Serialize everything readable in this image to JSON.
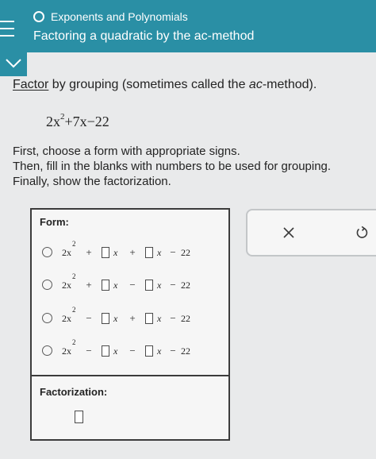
{
  "header": {
    "topic": "Exponents and Polynomials",
    "lesson": "Factoring a quadratic by the ac-method"
  },
  "icons": {
    "menu": "menu-icon",
    "topic": "circle-outline-icon",
    "collapse": "chevron-down-icon",
    "close": "close-icon",
    "undo": "undo-icon"
  },
  "problem": {
    "instruction_link": "Factor",
    "instruction_text": " by grouping (sometimes called the ",
    "instruction_ac": "ac",
    "instruction_tail": "-method).",
    "expression": {
      "coef": "2x",
      "exp": "2",
      "rest": "+7x−22"
    },
    "directions": [
      "First, choose a form with appropriate signs.",
      "Then, fill in the blanks with numbers to be used for grouping.",
      "Finally, show the factorization."
    ]
  },
  "form": {
    "label": "Form:",
    "options": [
      {
        "lead": "2x",
        "exp": "2",
        "op1": "+",
        "var1": "x",
        "op2": "+",
        "var2": "x",
        "const": "−",
        "num": "22"
      },
      {
        "lead": "2x",
        "exp": "2",
        "op1": "+",
        "var1": "x",
        "op2": "−",
        "var2": "x",
        "const": "−",
        "num": "22"
      },
      {
        "lead": "2x",
        "exp": "2",
        "op1": "−",
        "var1": "x",
        "op2": "+",
        "var2": "x",
        "const": "−",
        "num": "22"
      },
      {
        "lead": "2x",
        "exp": "2",
        "op1": "−",
        "var1": "x",
        "op2": "−",
        "var2": "x",
        "const": "−",
        "num": "22"
      }
    ]
  },
  "factorization": {
    "label": "Factorization:"
  },
  "colors": {
    "header": "#2a8fa5",
    "background": "#e9eaeb",
    "panel": "#f6f6f6",
    "border": "#3c3c3c"
  }
}
